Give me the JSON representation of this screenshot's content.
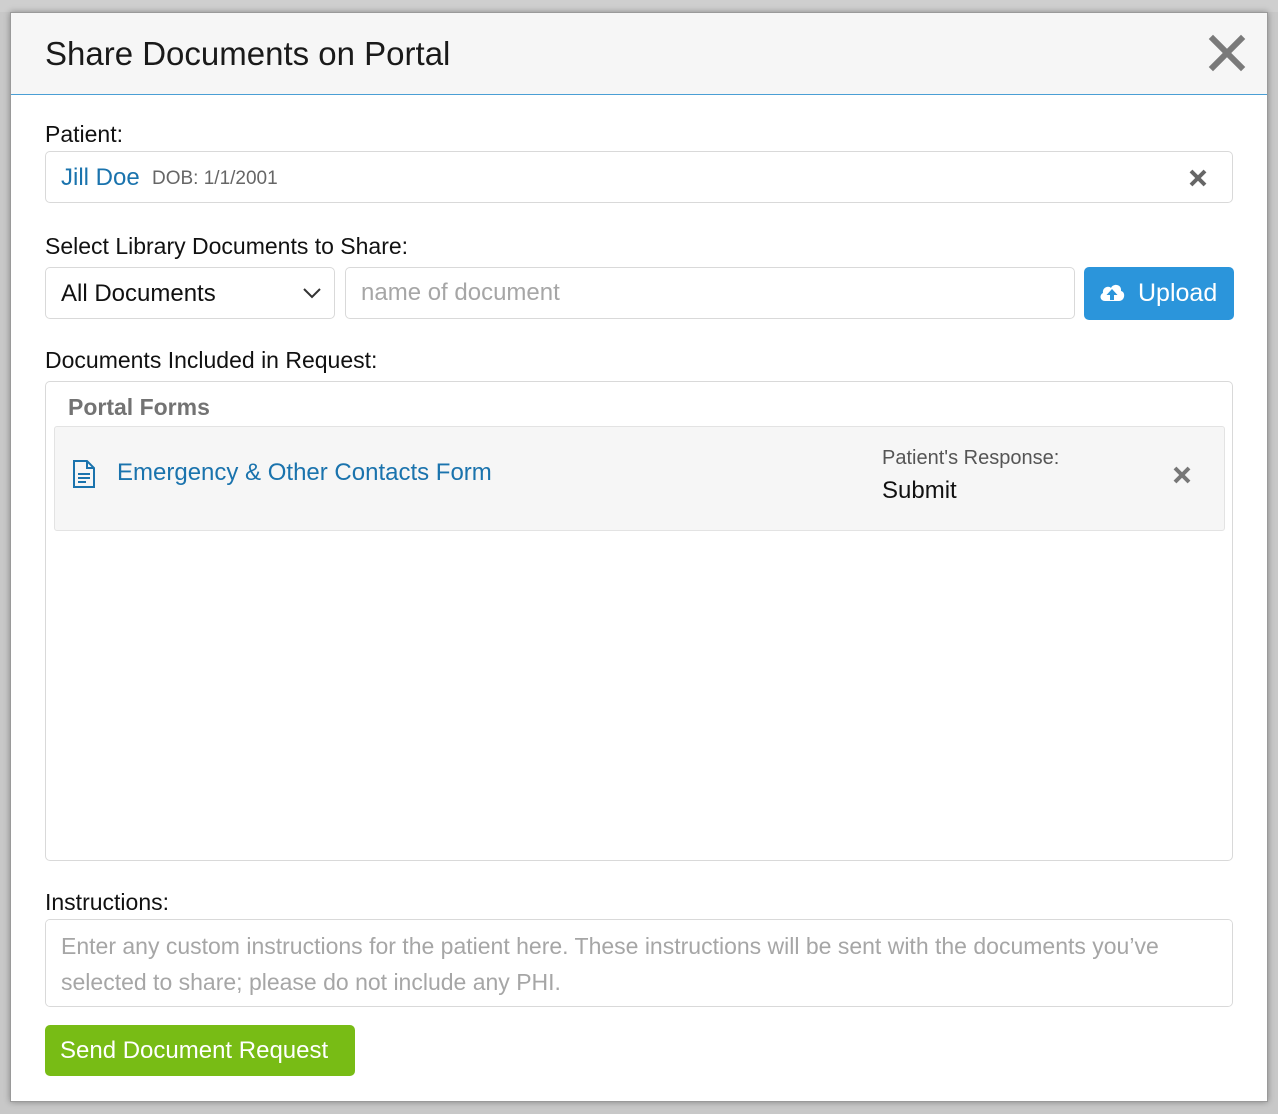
{
  "modal": {
    "title": "Share Documents on Portal",
    "close_icon": "close-icon"
  },
  "patient": {
    "label": "Patient:",
    "name": "Jill Doe",
    "dob": "DOB: 1/1/2001",
    "clear_icon": "clear-icon"
  },
  "library": {
    "label": "Select Library Documents to Share:",
    "filter_selected": "All Documents",
    "search_placeholder": "name of document",
    "search_value": "",
    "upload_label": "Upload",
    "upload_icon": "cloud-upload-icon"
  },
  "included": {
    "label": "Documents Included in Request:",
    "groups": [
      {
        "title": "Portal Forms",
        "items": [
          {
            "icon": "document-icon",
            "name": "Emergency & Other Contacts Form",
            "response_label": "Patient's Response:",
            "response_value": "Submit",
            "remove_icon": "remove-icon"
          }
        ]
      }
    ]
  },
  "instructions": {
    "label": "Instructions:",
    "placeholder": "Enter any custom instructions for the patient here. These instructions will be sent with the documents you’ve selected to share; please do not include any PHI.",
    "value": ""
  },
  "actions": {
    "send_label": "Send Document Request"
  },
  "colors": {
    "link": "#1a73ad",
    "upload_button": "#2b95db",
    "send_button": "#78bc15",
    "header_border": "#4a9fd5"
  }
}
